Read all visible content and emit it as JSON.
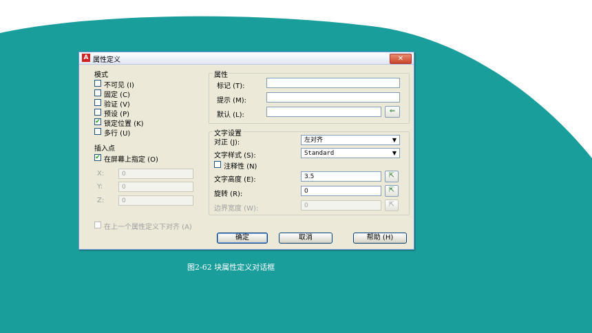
{
  "colors": {
    "teal_background": "#1a9e9c",
    "dialog_face": "#ece9d8"
  },
  "caption": "图2-62 块属性定义对话框",
  "dialog": {
    "title": "属性定义",
    "close_symbol": "✕",
    "app_icon_letter": "A",
    "mode": {
      "title": "模式",
      "options": [
        {
          "label": "不可见 (I)",
          "checked": false
        },
        {
          "label": "固定 (C)",
          "checked": false
        },
        {
          "label": "验证 (V)",
          "checked": false
        },
        {
          "label": "预设 (P)",
          "checked": false
        },
        {
          "label": "锁定位置 (K)",
          "checked": true
        },
        {
          "label": "多行 (U)",
          "checked": false
        }
      ]
    },
    "insertion": {
      "title": "插入点",
      "on_screen_label": "在屏幕上指定 (O)",
      "on_screen_checked": true,
      "x_label": "X:",
      "x_value": "0",
      "y_label": "Y:",
      "y_value": "0",
      "z_label": "Z:",
      "z_value": "0"
    },
    "attribute": {
      "title": "属性",
      "tag_label": "标记 (T):",
      "tag_value": "",
      "prompt_label": "提示 (M):",
      "prompt_value": "",
      "default_label": "默认 (L):",
      "default_value": "",
      "field_icon": "⇐"
    },
    "text": {
      "title": "文字设置",
      "justify_label": "对正 (J):",
      "justify_value": "左对齐",
      "style_label": "文字样式 (S):",
      "style_value": "Standard",
      "annotative_label": "注释性 (N)",
      "annotative_checked": false,
      "height_label": "文字高度 (E):",
      "height_value": "3.5",
      "rotation_label": "旋转 (R):",
      "rotation_value": "0",
      "width_label": "边界宽度 (W):",
      "width_value": "0",
      "pick_icon": "⇱"
    },
    "align_below_label": "在上一个属性定义下对齐 (A)",
    "align_below_checked": false,
    "buttons": {
      "ok": "确定",
      "cancel": "取消",
      "help": "帮助 (H)"
    },
    "dropdown_arrow": "▼"
  }
}
